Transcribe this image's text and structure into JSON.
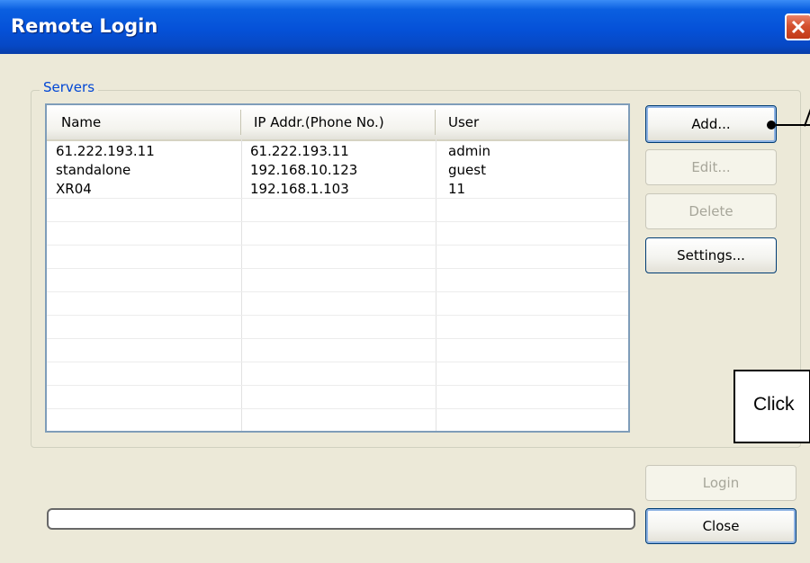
{
  "window": {
    "title": "Remote Login"
  },
  "servers": {
    "group_label": "Servers",
    "columns": [
      "Name",
      "IP Addr.(Phone No.)",
      "User"
    ],
    "rows": [
      {
        "name": "61.222.193.11",
        "ip": "61.222.193.11",
        "user": "admin"
      },
      {
        "name": "standalone",
        "ip": "192.168.10.123",
        "user": "guest"
      },
      {
        "name": "XR04",
        "ip": "192.168.1.103",
        "user": "11"
      }
    ]
  },
  "buttons": {
    "add": "Add...",
    "edit": "Edit...",
    "delete": "Delete",
    "settings": "Settings...",
    "login": "Login",
    "close": "Close"
  },
  "annotation": {
    "callout_text": "Click"
  },
  "progress": {
    "value": 0
  },
  "icons": {
    "close": "close-x-icon"
  },
  "colors": {
    "title_bar": "#0551d8",
    "group_label": "#0046d5",
    "close_button": "#d4502e"
  }
}
